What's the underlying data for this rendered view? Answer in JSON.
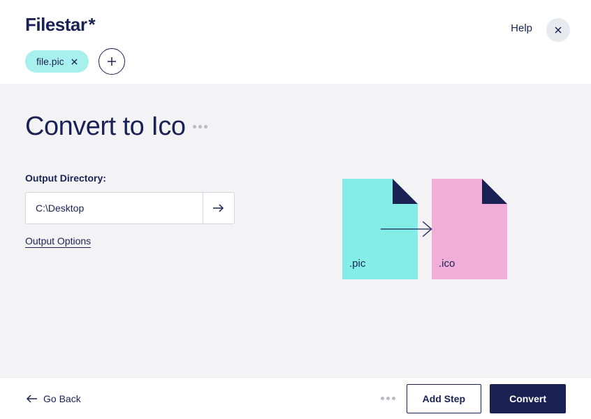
{
  "header": {
    "logo": "Filestar",
    "help_label": "Help"
  },
  "files": {
    "chip_name": "file.pic"
  },
  "main": {
    "title": "Convert to Ico",
    "output_dir_label": "Output Directory:",
    "output_dir_value": "C:\\Desktop",
    "output_options_label": "Output Options"
  },
  "graphic": {
    "source_ext": ".pic",
    "target_ext": ".ico"
  },
  "footer": {
    "go_back_label": "Go Back",
    "add_step_label": "Add Step",
    "convert_label": "Convert"
  }
}
